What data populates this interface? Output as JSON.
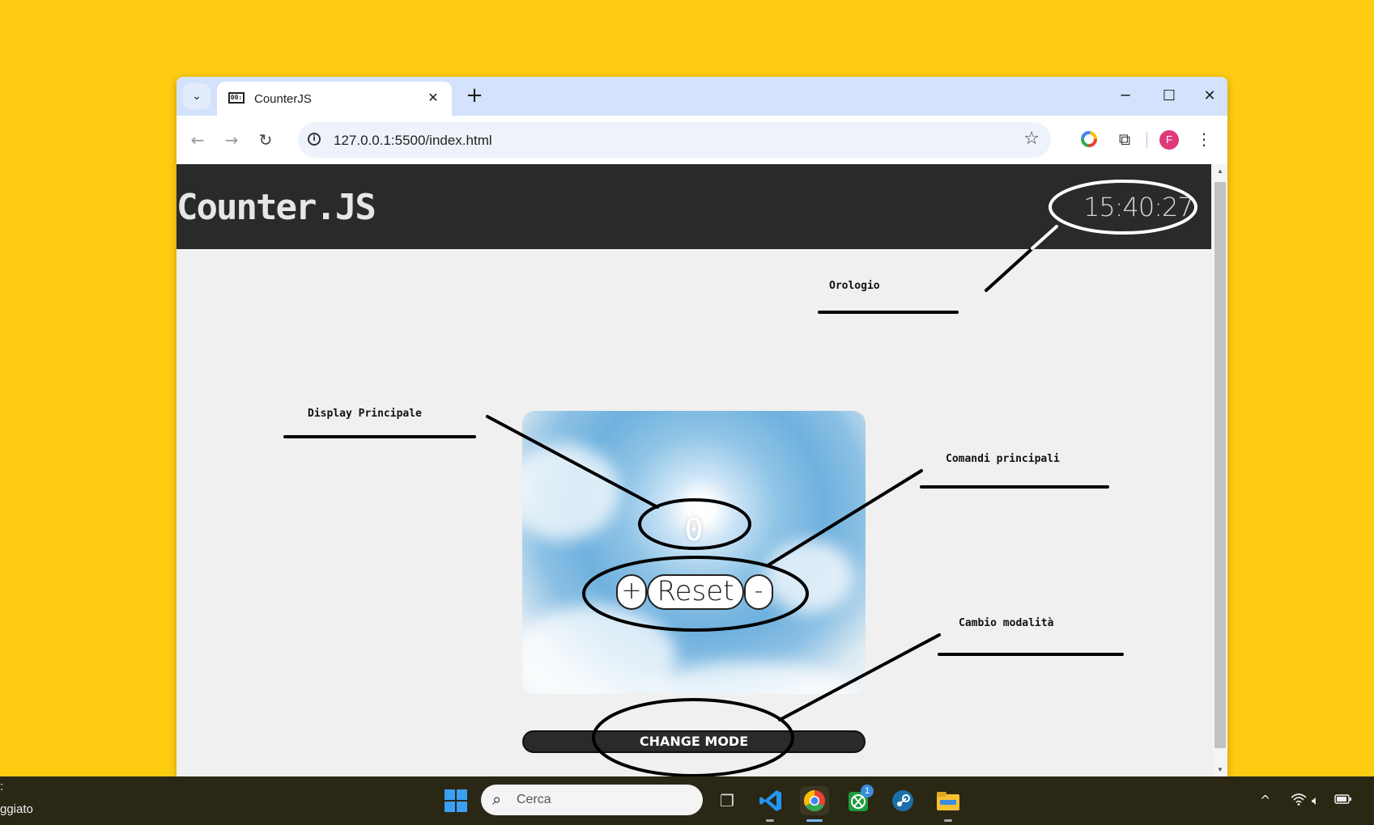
{
  "browser": {
    "tab_title": "CounterJS",
    "tab_favicon": "00:",
    "url": "127.0.0.1:5500/index.html",
    "profile_initial": "F"
  },
  "app": {
    "brand": "Counter.JS",
    "clock": "15:40:27",
    "counter_value": "0",
    "buttons": {
      "plus": "+",
      "reset": "Reset",
      "minus": "-"
    },
    "change_mode": "CHANGE MODE"
  },
  "annotations": {
    "clock": "Orologio",
    "display": "Display Principale",
    "controls": "Comandi principali",
    "mode": "Cambio modalità"
  },
  "taskbar": {
    "search_placeholder": "Cerca",
    "left_text_top": ":",
    "left_text_bottom": "ggiato",
    "xbox_badge": "1"
  },
  "colors": {
    "background": "#fecd12",
    "header": "#2a2a2a",
    "tabbar": "#d3e3fd"
  }
}
